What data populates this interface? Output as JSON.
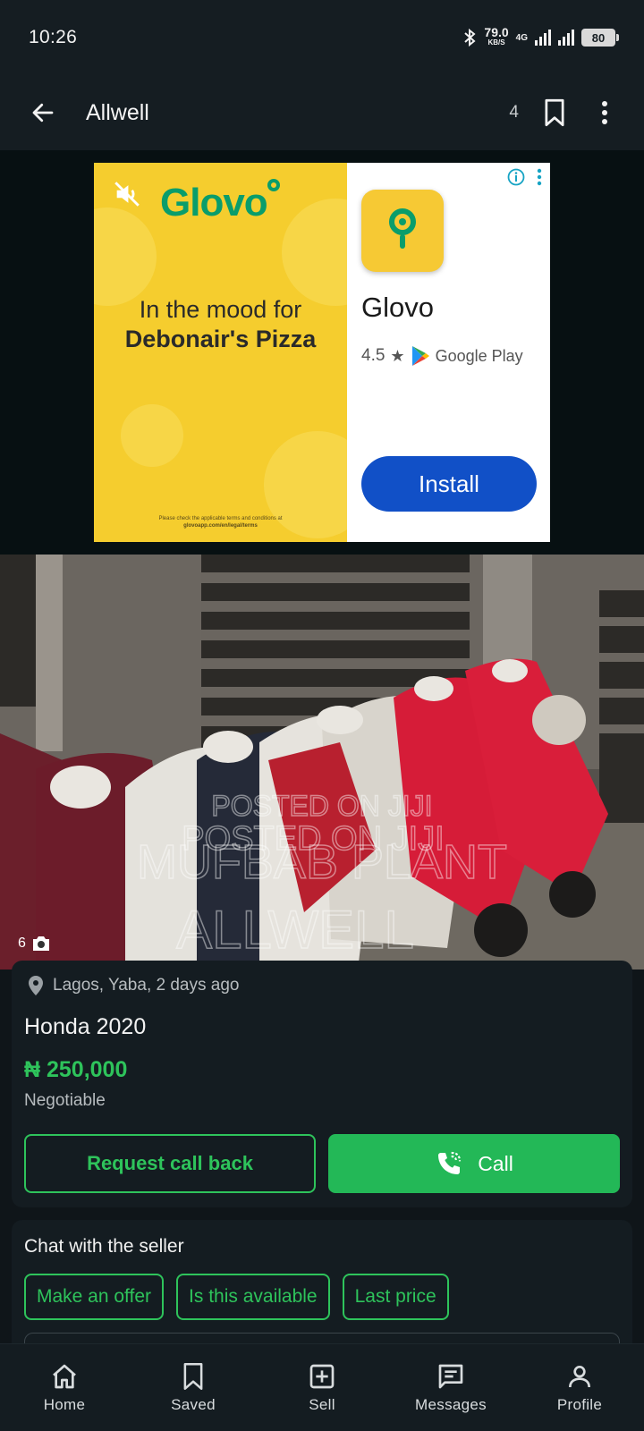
{
  "status_bar": {
    "time": "10:26",
    "net_speed_value": "79.0",
    "net_speed_unit": "KB/S",
    "network_type": "4G",
    "battery": "80"
  },
  "app_bar": {
    "title": "Allwell",
    "saved_count": "4"
  },
  "ad": {
    "brand": "Glovo",
    "headline_line1": "In the mood for",
    "headline_line2": "Debonair's Pizza",
    "fine_print_line1": "Please check the applicable terms and conditions at",
    "fine_print_line2": "glovoapp.com/en/legal/terms",
    "app_name": "Glovo",
    "rating": "4.5",
    "store": "Google Play",
    "install_label": "Install",
    "colors": {
      "panel": "#f5cd2e",
      "brand_green": "#0a9d6b",
      "install_blue": "#1150c7"
    }
  },
  "photo": {
    "count": "6",
    "watermark_line1": "POSTED ON JIJI",
    "watermark_line2": "POSTED ON JIJI",
    "watermark_line3": "MUFBAB PLANT",
    "watermark_line4": "ALLWELL"
  },
  "listing": {
    "location": "Lagos, Yaba, 2 days ago",
    "title": "Honda 2020",
    "price": "₦ 250,000",
    "price_note": "Negotiable",
    "request_callback_label": "Request call back",
    "call_label": "Call"
  },
  "chat": {
    "title": "Chat with the seller",
    "chips": [
      "Make an offer",
      "Is this available",
      "Last price"
    ]
  },
  "bottom_nav": {
    "items": [
      {
        "label": "Home",
        "icon": "home-icon"
      },
      {
        "label": "Saved",
        "icon": "bookmark-icon"
      },
      {
        "label": "Sell",
        "icon": "plus-square-icon"
      },
      {
        "label": "Messages",
        "icon": "message-icon"
      },
      {
        "label": "Profile",
        "icon": "person-icon"
      }
    ]
  },
  "colors": {
    "accent_green": "#2ec35b",
    "call_green": "#23b857",
    "surface": "#141c21",
    "app_bar": "#151d22"
  }
}
